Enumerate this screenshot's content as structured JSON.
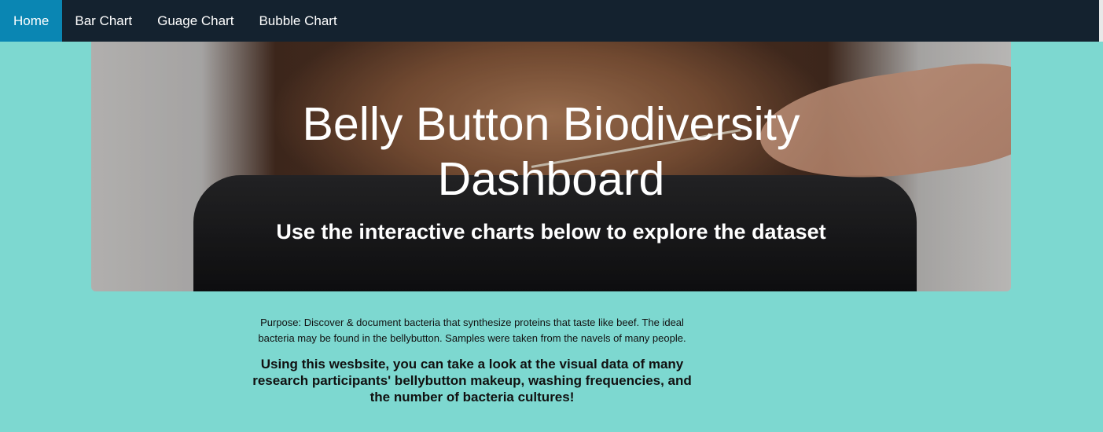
{
  "nav": {
    "items": [
      {
        "label": "Home",
        "active": true
      },
      {
        "label": "Bar Chart",
        "active": false
      },
      {
        "label": "Guage Chart",
        "active": false
      },
      {
        "label": "Bubble Chart",
        "active": false
      }
    ]
  },
  "hero": {
    "title_line1": "Belly Button Biodiversity",
    "title_line2": "Dashboard",
    "subtitle": "Use the interactive charts below to explore the dataset"
  },
  "content": {
    "purpose": "Purpose: Discover & document bacteria that synthesize proteins that taste like beef. The ideal bacteria may be found in the bellybutton. Samples were taken from the navels of many people.",
    "description": "Using this wesbsite, you can take a look at the visual data of many research participants' bellybutton makeup, washing frequencies, and the number of bacteria cultures!"
  },
  "colors": {
    "background": "#7dd8d0",
    "navbar": "#14222f",
    "nav_active": "#0a86b3"
  }
}
